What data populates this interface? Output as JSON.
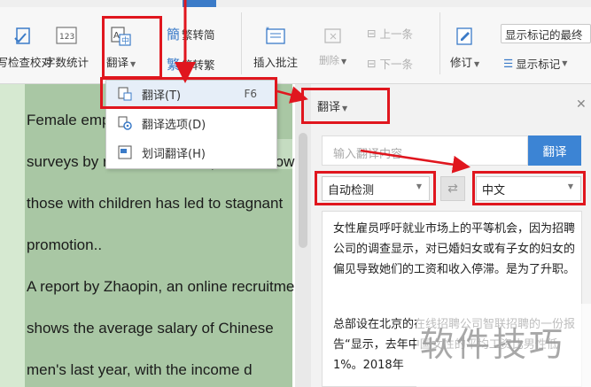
{
  "ribbon": {
    "proofread_label": "拼写检查校对",
    "word_count_label": "字数统计",
    "translate_label": "翻译",
    "trad_to_simp_label": "繁转简",
    "simp_to_trad_label": "简转繁",
    "insert_comment_label": "插入批注",
    "delete_label": "删除",
    "prev_label": "上一条",
    "next_label": "下一条",
    "revise_label": "修订",
    "show_markup_final_label": "显示标记的最终",
    "show_markup_label": "显示标记"
  },
  "menu": {
    "items": [
      {
        "label": "翻译(T)",
        "shortcut": "F6"
      },
      {
        "label": "翻译选项(D)",
        "shortcut": ""
      },
      {
        "label": "划词翻译(H)",
        "shortcut": ""
      }
    ]
  },
  "document": {
    "lines": [
      "Female employees call for equal",
      "surveys by recruitment companies show",
      "those with children has led to stagnant",
      "promotion..",
      "A report by Zhaopin, an online recruitment",
      "shows the average salary of Chinese",
      "men's last year, with the income d"
    ]
  },
  "panel": {
    "title": "翻译",
    "input_placeholder": "输入翻译内容",
    "translate_button": "翻译",
    "source_lang": "自动检测",
    "target_lang": "中文",
    "result_paragraph1": "女性雇员呼吁就业市场上的平等机会，因为招聘公司的调查显示，对已婚妇女或有子女的妇女的偏见导致她们的工资和收入停滞。是为了升职。",
    "result_paragraph2": "总部设在北京的在线招聘公司智联招聘的一份报告“显示，去年中国女性的平均工资比男性低1%。2018年"
  },
  "watermark": "软件技巧",
  "colors": {
    "highlight_red": "#e0161e",
    "translate_blue": "#3c84d4",
    "doc_green": "#a9c7a4"
  }
}
